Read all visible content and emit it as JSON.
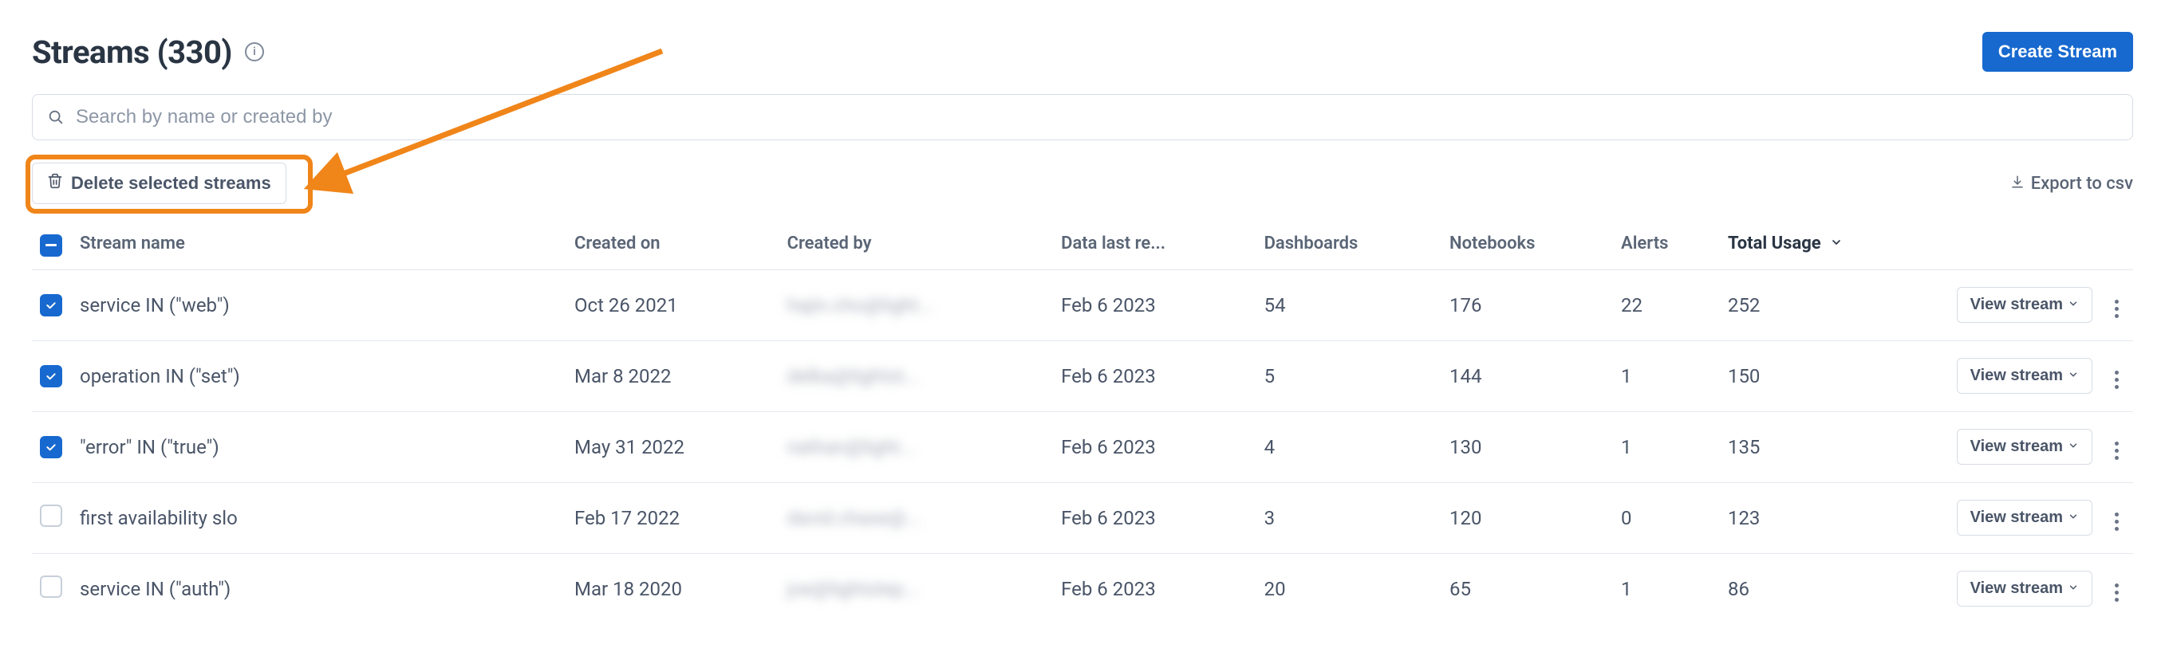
{
  "header": {
    "title": "Streams (330)",
    "create_label": "Create Stream"
  },
  "search": {
    "placeholder": "Search by name or created by"
  },
  "actions": {
    "delete_label": "Delete selected streams",
    "export_label": "Export to csv"
  },
  "columns": {
    "name": "Stream name",
    "created_on": "Created on",
    "created_by": "Created by",
    "last_received": "Data last re...",
    "dashboards": "Dashboards",
    "notebooks": "Notebooks",
    "alerts": "Alerts",
    "total_usage": "Total Usage"
  },
  "view_label": "View stream",
  "rows": [
    {
      "checked": true,
      "name": "service IN (\"web\")",
      "created_on": "Oct 26 2021",
      "created_by": "hajin.cho@light...",
      "last_received": "Feb 6 2023",
      "dashboards": "54",
      "notebooks": "176",
      "alerts": "22",
      "total_usage": "252"
    },
    {
      "checked": true,
      "name": "operation IN (\"set\")",
      "created_on": "Mar 8 2022",
      "created_by": "delba@lightst...",
      "last_received": "Feb 6 2023",
      "dashboards": "5",
      "notebooks": "144",
      "alerts": "1",
      "total_usage": "150"
    },
    {
      "checked": true,
      "name": "\"error\" IN (\"true\")",
      "created_on": "May 31 2022",
      "created_by": "nathan@light...",
      "last_received": "Feb 6 2023",
      "dashboards": "4",
      "notebooks": "130",
      "alerts": "1",
      "total_usage": "135"
    },
    {
      "checked": false,
      "name": "first availability slo",
      "created_on": "Feb 17 2022",
      "created_by": "david.chase@...",
      "last_received": "Feb 6 2023",
      "dashboards": "3",
      "notebooks": "120",
      "alerts": "0",
      "total_usage": "123"
    },
    {
      "checked": false,
      "name": "service IN (\"auth\")",
      "created_on": "Mar 18 2020",
      "created_by": "joe@lightstep...",
      "last_received": "Feb 6 2023",
      "dashboards": "20",
      "notebooks": "65",
      "alerts": "1",
      "total_usage": "86"
    }
  ]
}
